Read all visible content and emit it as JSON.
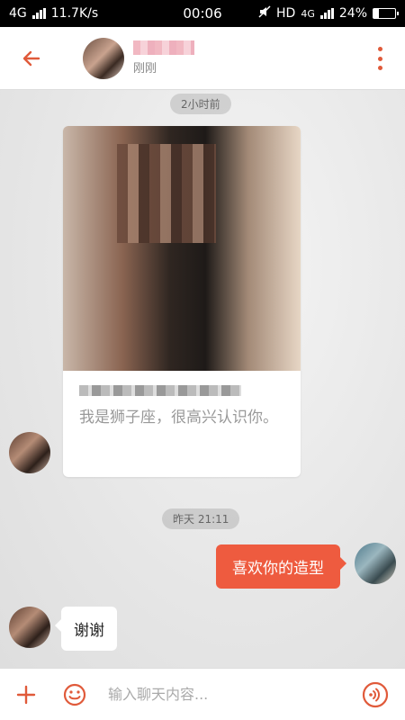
{
  "status_bar": {
    "network": "4G",
    "speed": "11.7K/s",
    "time": "00:06",
    "hd_label": "HD",
    "network2": "4G",
    "battery_percent": "24%",
    "battery_level": 0.24
  },
  "header": {
    "contact_status": "刚刚"
  },
  "chat": {
    "time_1": "2小时前",
    "card_text": "我是狮子座，很高兴认识你。",
    "time_2": "昨天 21:11",
    "my_message": "喜欢你的造型",
    "reply_message": "谢谢"
  },
  "input": {
    "placeholder": "输入聊天内容..."
  },
  "colors": {
    "accent": "#ee5b3f",
    "icon": "#e05a3a"
  }
}
